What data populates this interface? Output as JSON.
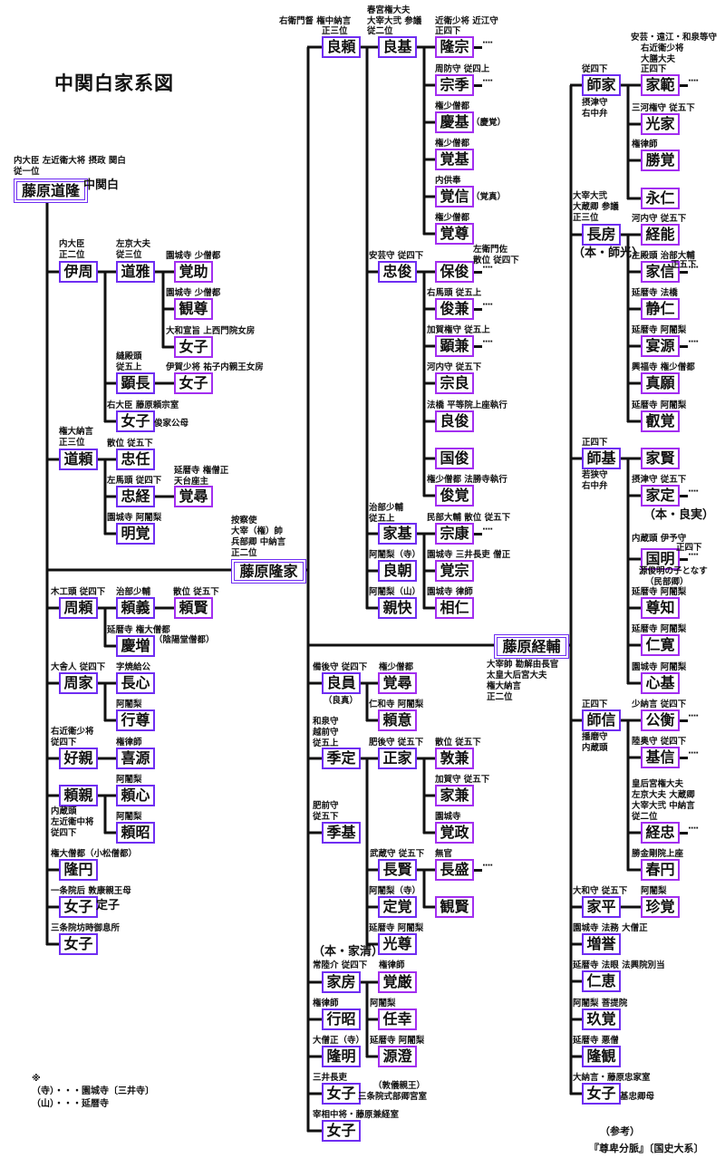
{
  "title": "中関白家系図",
  "colors": {
    "box_primary": "#6f2df2",
    "box_secondary": "#a22ef0",
    "line": "#111111"
  },
  "footnote": {
    "mark": "※",
    "lines": [
      "（寺）・・・園城寺〔三井寺〕",
      "（山）・・・延暦寺"
    ]
  },
  "reference": {
    "label": "（参考）",
    "source": "『尊卑分脈』〔国史大系〕"
  },
  "persons": [
    {
      "name": "藤原道隆",
      "notes": [
        "内大臣 左近衛大将 摂政 関白",
        "従一位",
        "中関白"
      ]
    },
    {
      "name": "伊周",
      "notes": [
        "内大臣",
        "正二位"
      ]
    },
    {
      "name": "道雅",
      "notes": [
        "左京大夫",
        "従三位"
      ]
    },
    {
      "name": "覚助",
      "notes": [
        "園城寺 少僧都"
      ]
    },
    {
      "name": "観尊",
      "notes": [
        "園城寺 少僧都"
      ]
    },
    {
      "name": "女子",
      "notes": [
        "大和宣旨 上西門院女房"
      ]
    },
    {
      "name": "顕長",
      "notes": [
        "縫殿頭",
        "従五上"
      ]
    },
    {
      "name": "女子",
      "notes": [
        "伊賀少将 祐子内親王女房"
      ]
    },
    {
      "name": "女子",
      "notes": [
        "右大臣 藤原頼宗室",
        "俊家公母"
      ]
    },
    {
      "name": "道頼",
      "notes": [
        "権大納言",
        "正三位"
      ]
    },
    {
      "name": "忠任",
      "notes": [
        "散位 従五下"
      ]
    },
    {
      "name": "忠経",
      "notes": [
        "左馬頭 従四下"
      ]
    },
    {
      "name": "覚尋",
      "notes": [
        "延暦寺 権僧正",
        "天台座主"
      ]
    },
    {
      "name": "明覚",
      "notes": [
        "園城寺 阿闍梨"
      ]
    },
    {
      "name": "藤原隆家",
      "notes": [
        "按察使",
        "大宰（権）帥",
        "兵部卿 中納言",
        "正二位"
      ]
    },
    {
      "name": "周頼",
      "notes": [
        "木工頭 従四下"
      ]
    },
    {
      "name": "頼義",
      "notes": [
        "治部少輔"
      ]
    },
    {
      "name": "頼賢",
      "notes": [
        "散位 従五下"
      ]
    },
    {
      "name": "慶増",
      "notes": [
        "延暦寺 権大僧都",
        "（陰陽堂僧都）"
      ]
    },
    {
      "name": "周家",
      "notes": [
        "大舎人 従四下"
      ]
    },
    {
      "name": "長心",
      "notes": [
        "字焼給公"
      ]
    },
    {
      "name": "行尊",
      "notes": [
        "阿闍梨"
      ]
    },
    {
      "name": "好親",
      "notes": [
        "右近衛少将",
        "従四下"
      ]
    },
    {
      "name": "喜源",
      "notes": [
        "権律師"
      ]
    },
    {
      "name": "頼親",
      "notes": [
        "内蔵頭",
        "左近衛中将",
        "従四下"
      ]
    },
    {
      "name": "頼心",
      "notes": [
        "阿闍梨"
      ]
    },
    {
      "name": "頼昭",
      "notes": [
        "阿闍梨"
      ]
    },
    {
      "name": "隆円",
      "notes": [
        "権大僧都（小松僧都）"
      ]
    },
    {
      "name": "女子",
      "notes": [
        "一条院后 敦康親王母",
        "定子"
      ]
    },
    {
      "name": "女子",
      "notes": [
        "三条院坊時御息所"
      ]
    },
    {
      "name": "良頼",
      "notes": [
        "右衛門督 権中納言",
        "正三位"
      ]
    },
    {
      "name": "良基",
      "notes": [
        "春宮権大夫",
        "大宰大弐 参議",
        "従二位"
      ]
    },
    {
      "name": "隆宗",
      "notes": [
        "近衛少将 近江守",
        "正四下"
      ]
    },
    {
      "name": "宗季",
      "notes": [
        "周防守 従四上"
      ]
    },
    {
      "name": "慶基",
      "notes": [
        "権少僧都",
        "（慶覚）"
      ]
    },
    {
      "name": "覚基",
      "notes": [
        "権少僧都"
      ]
    },
    {
      "name": "覚信",
      "notes": [
        "内供奉",
        "（覚真）"
      ]
    },
    {
      "name": "覚尊",
      "notes": [
        "権少僧都"
      ]
    },
    {
      "name": "忠俊",
      "notes": [
        "安芸守 従四下"
      ]
    },
    {
      "name": "保俊",
      "notes": [
        "左衛門佐",
        "散位 従四下"
      ]
    },
    {
      "name": "俊兼",
      "notes": [
        "右馬頭 従五上"
      ]
    },
    {
      "name": "顕兼",
      "notes": [
        "加賀権守 従五上"
      ]
    },
    {
      "name": "宗良",
      "notes": [
        "河内守 従五下"
      ]
    },
    {
      "name": "良俊",
      "notes": [
        "法橋 平等院上座執行"
      ]
    },
    {
      "name": "国俊",
      "notes": []
    },
    {
      "name": "俊覚",
      "notes": [
        "権少僧都 法勝寺執行"
      ]
    },
    {
      "name": "家基",
      "notes": [
        "治部少輔",
        "従五上"
      ]
    },
    {
      "name": "宗康",
      "notes": [
        "民部大輔 散位 従五下"
      ]
    },
    {
      "name": "良朝",
      "notes": [
        "阿闍梨（寺）"
      ]
    },
    {
      "name": "覚宗",
      "notes": [
        "園城寺 三井長吏 僧正"
      ]
    },
    {
      "name": "親快",
      "notes": [
        "阿闍梨（山）"
      ]
    },
    {
      "name": "相仁",
      "notes": [
        "園城寺 律師"
      ]
    },
    {
      "name": "藤原経輔",
      "notes": [
        "大宰帥 勘解由長官",
        "太皇大后宮大夫",
        "権大納言",
        "正二位"
      ]
    },
    {
      "name": "良員",
      "notes": [
        "備後守 従四下",
        "（良真）"
      ]
    },
    {
      "name": "覚尋",
      "notes": [
        "権少僧都"
      ]
    },
    {
      "name": "頼意",
      "notes": [
        "仁和寺 阿闍梨"
      ]
    },
    {
      "name": "季定",
      "notes": [
        "和泉守",
        "越前守",
        "従五上"
      ]
    },
    {
      "name": "正家",
      "notes": [
        "肥後守 従五下"
      ]
    },
    {
      "name": "敦兼",
      "notes": [
        "散位 従五下"
      ]
    },
    {
      "name": "家兼",
      "notes": [
        "加賀守 従五下"
      ]
    },
    {
      "name": "覚政",
      "notes": [
        "園城寺"
      ]
    },
    {
      "name": "季基",
      "notes": [
        "肥前守",
        "従五下"
      ]
    },
    {
      "name": "長賢",
      "notes": [
        "武蔵守 従五下"
      ]
    },
    {
      "name": "長盛",
      "notes": [
        "無官"
      ]
    },
    {
      "name": "観賢",
      "notes": []
    },
    {
      "name": "定覚",
      "notes": [
        "阿闍梨（寺）"
      ]
    },
    {
      "name": "光尊",
      "notes": [
        "延暦寺 阿闍梨"
      ]
    },
    {
      "name": "家房",
      "notes": [
        "（本・家清）",
        "常陸介 従四下"
      ]
    },
    {
      "name": "覚厳",
      "notes": [
        "権律師"
      ]
    },
    {
      "name": "任幸",
      "notes": [
        "阿闍梨"
      ]
    },
    {
      "name": "源澄",
      "notes": [
        "延暦寺 阿闍梨"
      ]
    },
    {
      "name": "行昭",
      "notes": [
        "権律師"
      ]
    },
    {
      "name": "隆明",
      "notes": [
        "大僧正（寺）"
      ]
    },
    {
      "name": "女子",
      "notes": [
        "三井長吏",
        "（敦儀親王）",
        "三条院式部卿宮室"
      ]
    },
    {
      "name": "女子",
      "notes": [
        "宰相中将・藤原兼経室"
      ]
    },
    {
      "name": "師家",
      "notes": [
        "従四下",
        "摂津守",
        "右中弁"
      ]
    },
    {
      "name": "家範",
      "notes": [
        "安芸・遠江・和泉等守",
        "右近衛少将",
        "大膳大夫",
        "正四下"
      ]
    },
    {
      "name": "光家",
      "notes": [
        "三河権守 従五下"
      ]
    },
    {
      "name": "勝覚",
      "notes": [
        "権律師"
      ]
    },
    {
      "name": "永仁",
      "notes": []
    },
    {
      "name": "長房",
      "notes": [
        "大宰大弐",
        "大蔵卿 参議",
        "正三位",
        "（本・師光）"
      ]
    },
    {
      "name": "経能",
      "notes": [
        "河内守 従五下"
      ]
    },
    {
      "name": "家信",
      "notes": [
        "主殿頭 治部大輔",
        "正五下"
      ]
    },
    {
      "name": "静仁",
      "notes": [
        "延暦寺 法橋"
      ]
    },
    {
      "name": "宴源",
      "notes": [
        "延暦寺 阿闍梨"
      ]
    },
    {
      "name": "真願",
      "notes": [
        "興福寺 権少僧都"
      ]
    },
    {
      "name": "叡覚",
      "notes": [
        "延暦寺 阿闍梨"
      ]
    },
    {
      "name": "師基",
      "notes": [
        "正四下",
        "若狭守",
        "右中弁"
      ]
    },
    {
      "name": "家賢",
      "notes": []
    },
    {
      "name": "家定",
      "notes": [
        "摂津守 従五下",
        "（本・良実）"
      ]
    },
    {
      "name": "国明",
      "notes": [
        "内蔵頭 伊予守",
        "正四下",
        "源俊明の子となす",
        "（民部卿）"
      ]
    },
    {
      "name": "尊知",
      "notes": [
        "延暦寺 阿闍梨"
      ]
    },
    {
      "name": "仁寛",
      "notes": [
        "延暦寺 阿闍梨"
      ]
    },
    {
      "name": "心基",
      "notes": [
        "園城寺 阿闍梨"
      ]
    },
    {
      "name": "師信",
      "notes": [
        "正四下",
        "播磨守",
        "内蔵頭"
      ]
    },
    {
      "name": "公衡",
      "notes": [
        "少納言 従四下"
      ]
    },
    {
      "name": "基信",
      "notes": [
        "陸奥守 従四下"
      ]
    },
    {
      "name": "経忠",
      "notes": [
        "皇后宮権大夫",
        "左京大夫 大蔵卿",
        "大宰大弐 中納言",
        "従二位"
      ]
    },
    {
      "name": "春円",
      "notes": [
        "勝金剛院上座"
      ]
    },
    {
      "name": "家平",
      "notes": [
        "大和守 従五下"
      ]
    },
    {
      "name": "珍覚",
      "notes": [
        "阿闍梨"
      ]
    },
    {
      "name": "増誉",
      "notes": [
        "園城寺 法務 大僧正"
      ]
    },
    {
      "name": "仁恵",
      "notes": [
        "延暦寺 法眼 法興院別当"
      ]
    },
    {
      "name": "玖覚",
      "notes": [
        "阿闍梨 菩提院"
      ]
    },
    {
      "name": "隆観",
      "notes": [
        "延暦寺 悪僧"
      ]
    },
    {
      "name": "女子",
      "notes": [
        "大納言・藤原忠家室",
        "基忠卿母"
      ]
    }
  ]
}
